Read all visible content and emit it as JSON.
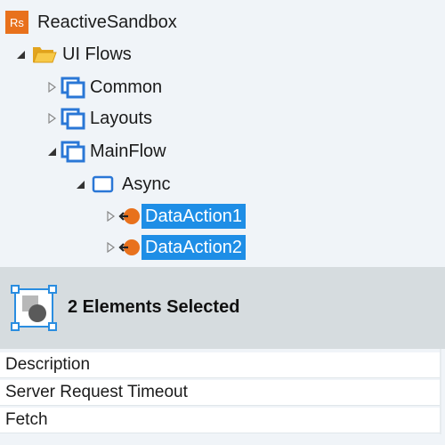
{
  "tree": {
    "root": {
      "badge": "Rs",
      "label": "ReactiveSandbox",
      "badge_color": "#e8711c"
    },
    "ui_flows": {
      "label": "UI Flows"
    },
    "common": {
      "label": "Common"
    },
    "layouts": {
      "label": "Layouts"
    },
    "mainflow": {
      "label": "MainFlow"
    },
    "async": {
      "label": "Async"
    },
    "data_actions": [
      {
        "label": "DataAction1"
      },
      {
        "label": "DataAction2"
      }
    ]
  },
  "panel": {
    "title": "2 Elements Selected"
  },
  "properties": [
    {
      "label": "Description"
    },
    {
      "label": "Server Request Timeout"
    },
    {
      "label": "Fetch"
    }
  ],
  "colors": {
    "selection": "#1e8ee6",
    "accent_orange": "#e8711c",
    "flow_blue": "#2a77d6"
  }
}
